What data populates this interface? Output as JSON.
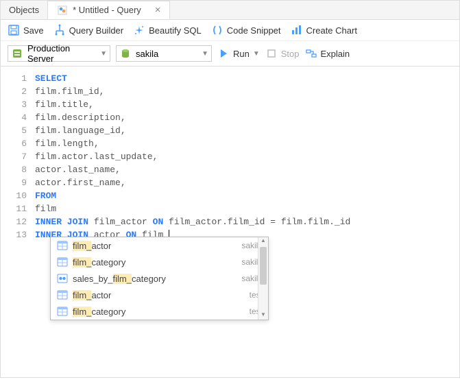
{
  "tabs": {
    "objects": "Objects",
    "query": "* Untitled - Query"
  },
  "toolbar": {
    "save": "Save",
    "query_builder": "Query Builder",
    "beautify": "Beautify SQL",
    "code_snippet": "Code Snippet",
    "create_chart": "Create Chart"
  },
  "toolbar2": {
    "server": "Production Server",
    "database": "sakila",
    "run": "Run",
    "stop": "Stop",
    "explain": "Explain"
  },
  "code": {
    "lines": [
      {
        "n": "1",
        "html": "<span class='kw'>SELECT</span>"
      },
      {
        "n": "2",
        "html": "film.film_id,"
      },
      {
        "n": "3",
        "html": "film.title,"
      },
      {
        "n": "4",
        "html": "film.description,"
      },
      {
        "n": "5",
        "html": "film.language_id,"
      },
      {
        "n": "6",
        "html": "film.length,"
      },
      {
        "n": "7",
        "html": "film.actor.last_update,"
      },
      {
        "n": "8",
        "html": "actor.last_name,"
      },
      {
        "n": "9",
        "html": "actor.first_name,"
      },
      {
        "n": "10",
        "html": "<span class='kw'>FROM</span>"
      },
      {
        "n": "11",
        "html": "film"
      },
      {
        "n": "12",
        "html": "<span class='kw'>INNER JOIN</span> film_actor <span class='kw'>ON</span> film_actor.film_id = film.film._id"
      },
      {
        "n": "13",
        "html": "<span class='kw'>INNER JOIN</span> actor <span class='kw'>ON</span> film_<span class='cursor'></span>"
      }
    ]
  },
  "autocomplete": {
    "items": [
      {
        "icon": "table",
        "label": "<span class='hl'>film_</span>actor",
        "schema": "sakila"
      },
      {
        "icon": "table",
        "label": "<span class='hl'>film_</span>category",
        "schema": "sakila"
      },
      {
        "icon": "view",
        "label": "sales_by_<span class='hl'>film_</span>category",
        "schema": "sakila"
      },
      {
        "icon": "table",
        "label": "<span class='hl'>film_</span>actor",
        "schema": "test"
      },
      {
        "icon": "table",
        "label": "<span class='hl'>film_</span>category",
        "schema": "test"
      }
    ]
  }
}
